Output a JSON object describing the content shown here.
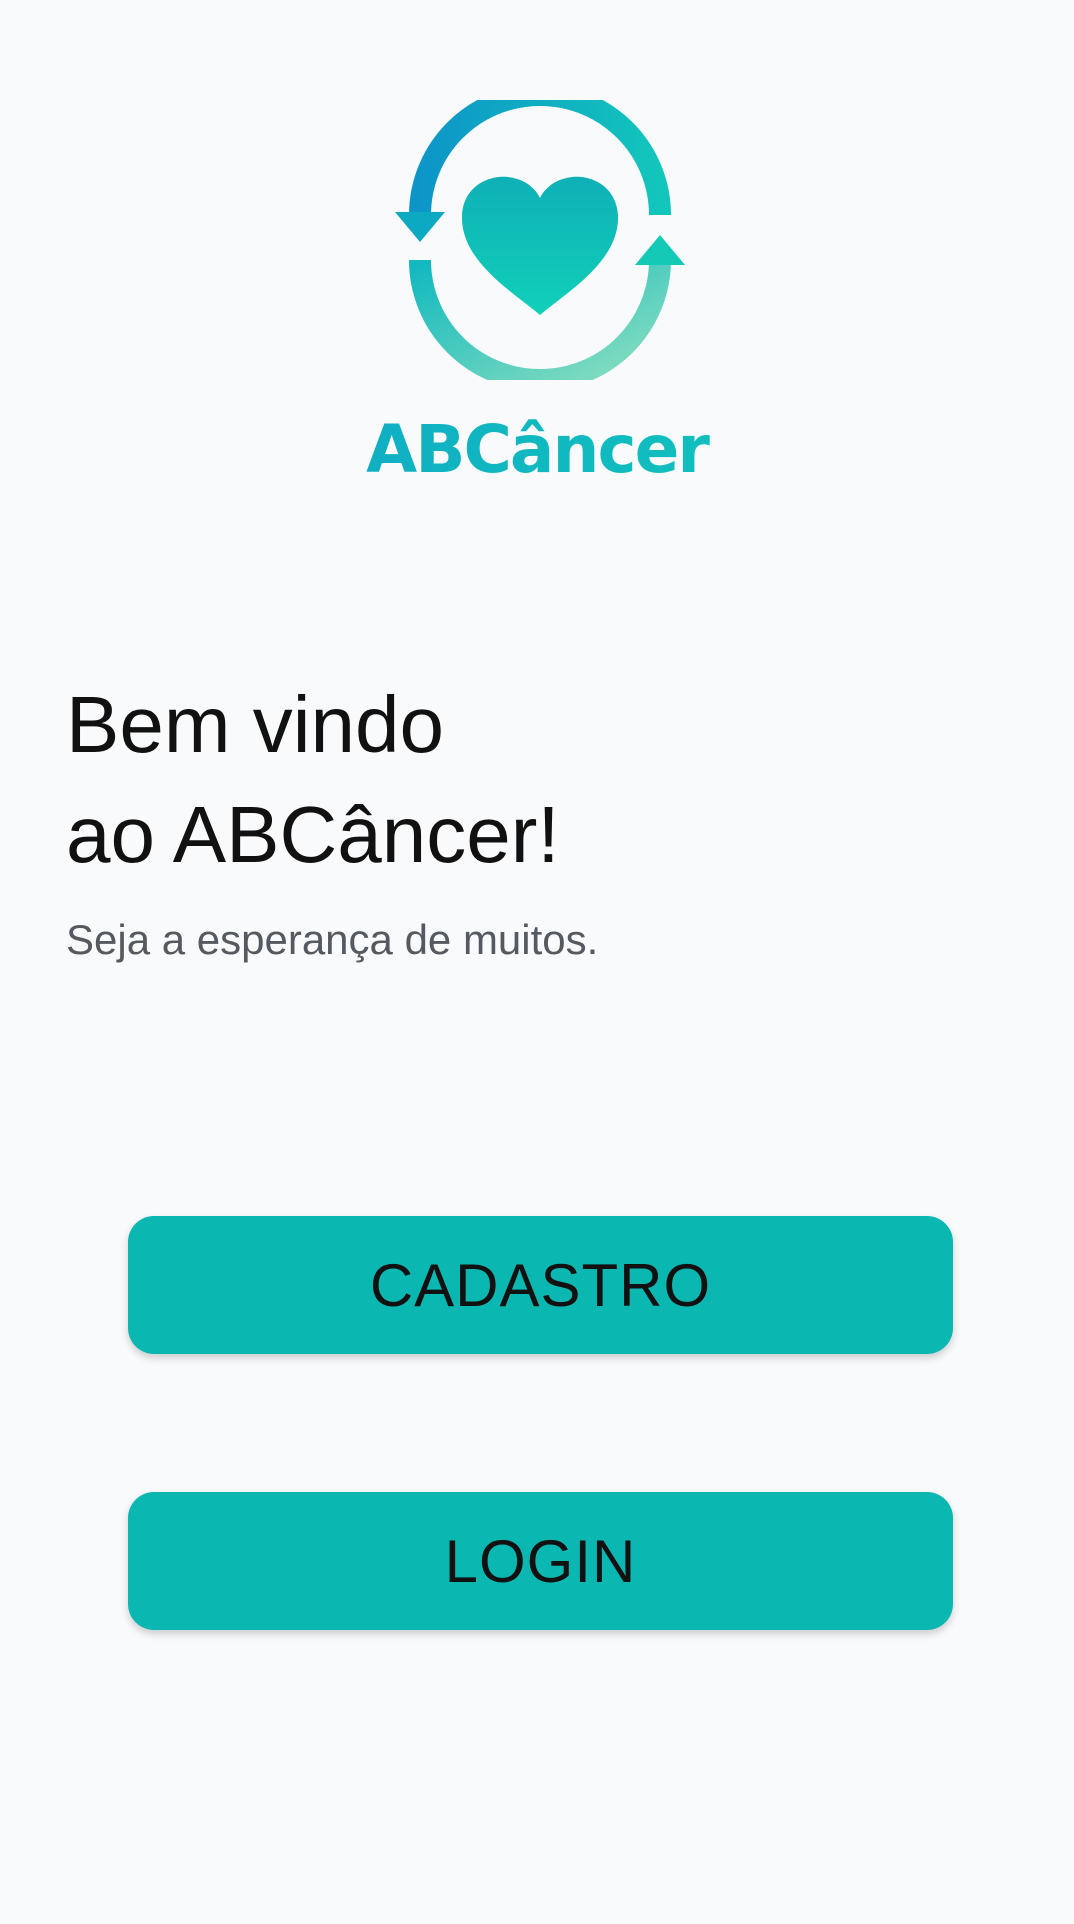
{
  "brand": {
    "name": "ABCâncer",
    "logo_icon": "heart-cycle-icon",
    "colors": {
      "primary": "#0bb8b1",
      "gradient_start": "#0e9cc6",
      "gradient_end": "#14cdb8"
    }
  },
  "welcome": {
    "line1": "Bem vindo",
    "line2": "ao ABCâncer!",
    "tagline": "Seja a esperança de muitos."
  },
  "actions": {
    "signup_label": "CADASTRO",
    "login_label": "LOGIN"
  }
}
